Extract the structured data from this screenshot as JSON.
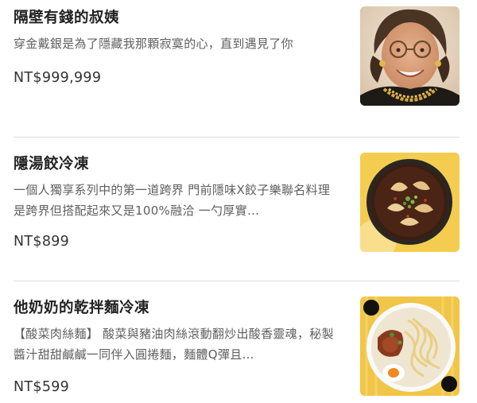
{
  "products": [
    {
      "title": "隔壁有錢的叔姨",
      "description": "穿金戴銀是為了隱藏我那顆寂寞的心，直到遇見了你",
      "price": "NT$999,999",
      "image_icon": "portrait-photo"
    },
    {
      "title": "隱湯餃冷凍",
      "description": "一個人獨享系列中的第一道跨界 門前隱味X餃子樂聯名料理 是跨界但搭配起來又是100%融洽 一勺厚實…",
      "price": "NT$899",
      "image_icon": "dumpling-soup-photo"
    },
    {
      "title": "他奶奶的乾拌麵冷凍",
      "description": "【酸菜肉絲麵】 酸菜與豬油肉絲滾動翻炒出酸香靈魂，秘製醬汁甜甜鹹鹹一同伴入圓捲麵，麵體Q彈且…",
      "price": "NT$599",
      "image_icon": "dry-noodles-photo"
    }
  ],
  "colors": {
    "title": "#222222",
    "description": "#5f5f5f",
    "price": "#333333",
    "divider": "#dcdcdc"
  }
}
